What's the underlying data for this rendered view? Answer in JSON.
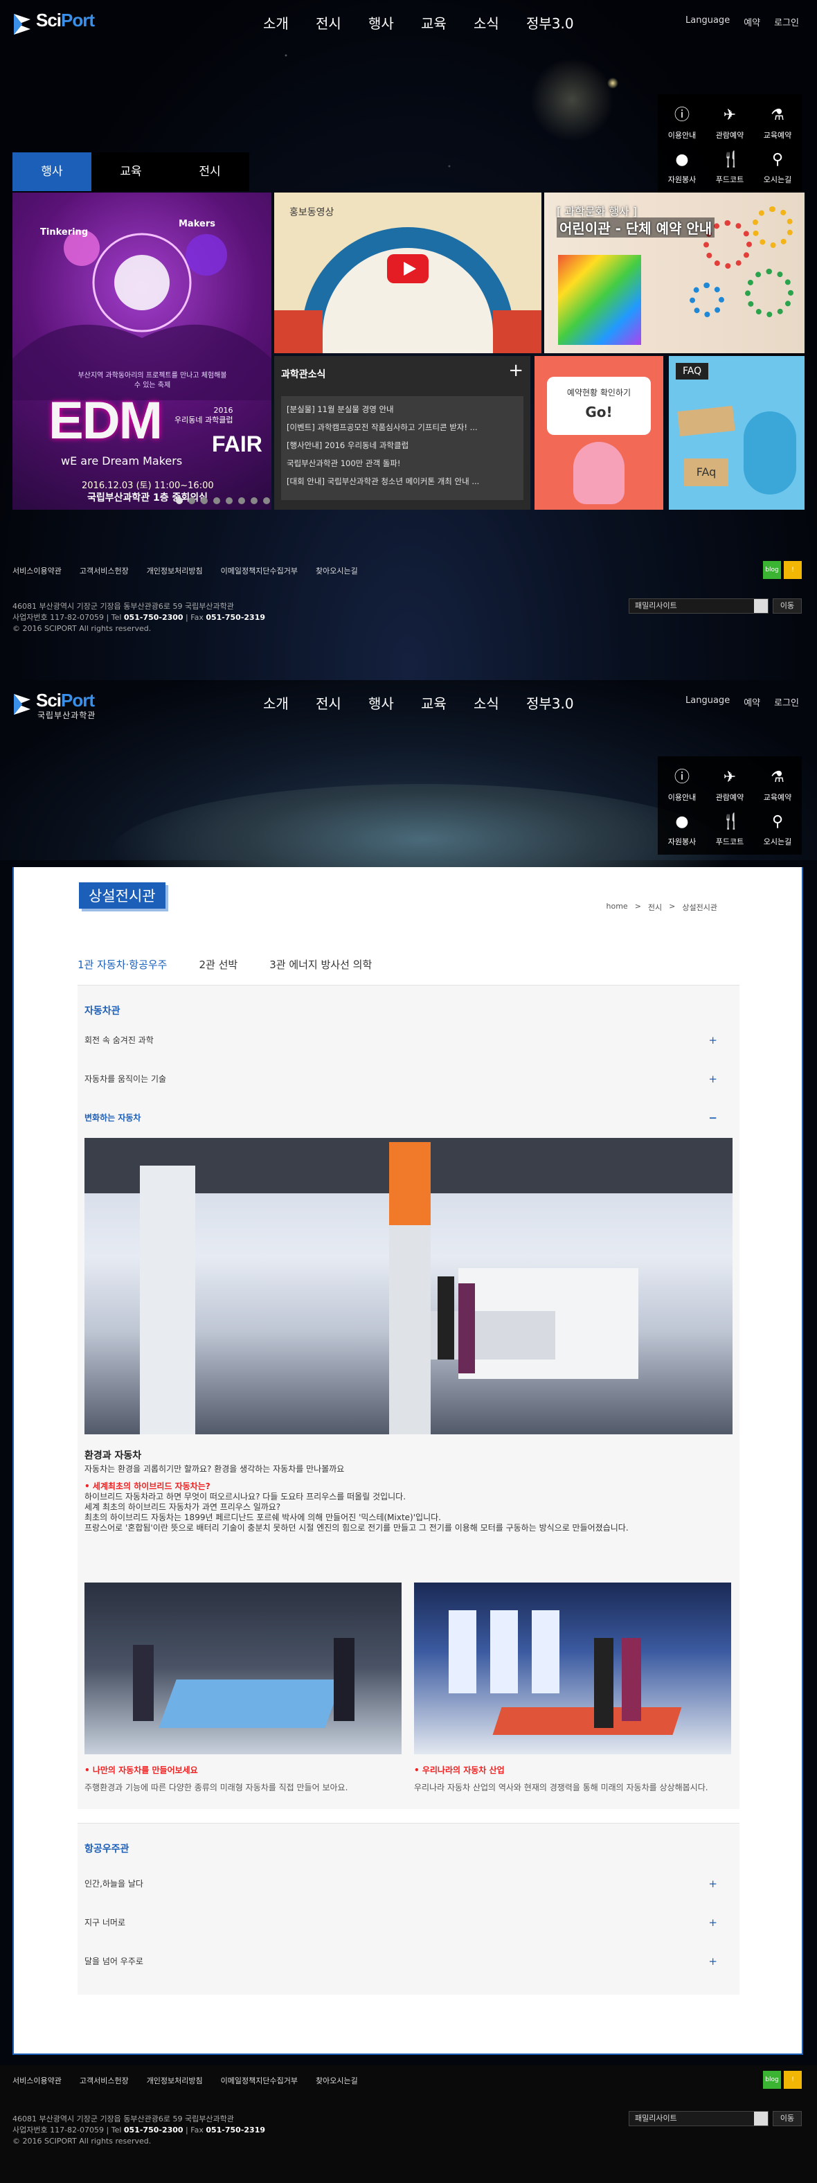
{
  "brand": {
    "name_a": "Sci",
    "name_b": "Port",
    "sub": "국립부산과학관"
  },
  "nav": [
    "소개",
    "전시",
    "행사",
    "교육",
    "소식",
    "정부3.0"
  ],
  "util": [
    "Language",
    "예약",
    "로그인"
  ],
  "quick": [
    {
      "label": "이용안내",
      "icon": "info-icon"
    },
    {
      "label": "관람예약",
      "icon": "plane-icon"
    },
    {
      "label": "교육예약",
      "icon": "flask-icon"
    },
    {
      "label": "자원봉사",
      "icon": "person-icon"
    },
    {
      "label": "푸드코트",
      "icon": "food-icon"
    },
    {
      "label": "오시는길",
      "icon": "pin-icon"
    }
  ],
  "tabs": [
    "행사",
    "교육",
    "전시"
  ],
  "edm": {
    "marks": [
      "Tinkering",
      "Makers"
    ],
    "msg": "부산지역 과학동아리의 프로젝트를 만나고 체험해볼 수 있는 축제",
    "yr": "2016\n우리동네 과학클럽",
    "big": "EDM",
    "fair": "FAIR",
    "we": "wE are Dream Makers",
    "date": "2016.12.03 (토) 11:00~16:00",
    "place": "국립부산과학관 1층 중회의실"
  },
  "video": {
    "label": "홍보동영상"
  },
  "event": {
    "kicker": "[ 과학문화 행사 ]",
    "title": "어린이관 - 단체 예약 안내"
  },
  "news": {
    "title": "과학관소식",
    "items": [
      "[분실물] 11월 분실물 경영 안내",
      "[이벤트] 과학캠프공모전 작품심사하고 기프티콘 받자! ...",
      "[행사안내] 2016 우리동네 과학클럽",
      "국립부산과학관 100만 관객 돌파!",
      "[대회 안내] 국립부산과학관 청소년 메이커톤 개최 안내 ..."
    ]
  },
  "reserve": {
    "line1": "예약현황 확인하기",
    "line2": "Go!"
  },
  "faq": {
    "label": "FAQ",
    "sign": "FAq"
  },
  "footer": {
    "links": [
      "서비스이용약관",
      "고객서비스헌장",
      "개인정보처리방침",
      "이메일정책지단수집거부",
      "찾아오시는길"
    ],
    "addr1": "46081 부산광역시 기장군 기장읍 동부산관광6로 59 국립부산과학관",
    "addr2a": "사업자번호 117-82-07059 | Tel ",
    "tel": "051-750-2300",
    "addr2b": " | Fax ",
    "fax": "051-750-2319",
    "copy": "© 2016 SCIPORT All rights reserved.",
    "family": "패밀리사이트",
    "go": "이동",
    "badge1": "blog",
    "badge2": "!"
  },
  "sub": {
    "title": "상설전시관",
    "breadcrumb": [
      "home",
      ">",
      "전시",
      ">",
      "상설전시관"
    ],
    "tabs": [
      "1관 자동차·항공우주",
      "2관 선박",
      "3관 에너지 방사선 의학"
    ],
    "sec1": {
      "head": "자동차관",
      "items": [
        {
          "label": "회전 속 숨겨진 과학",
          "pm": "+"
        },
        {
          "label": "자동차를 움직이는 기술",
          "pm": "+"
        },
        {
          "label": "변화하는 자동차",
          "pm": "−"
        }
      ],
      "h4": "환경과 자동차",
      "p1": "자동차는 환경을 괴롭히기만 할까요? 환경을 생각하는 자동차를 만나볼까요",
      "red": "• 세계최초의 하이브리드 자동차는?",
      "p2": "하이브리드 자동차라고 하면 무엇이 떠오르시나요? 다들 도요타 프리우스를 떠올릴 것입니다.",
      "p3": "세계 최초의 하이브리드 자동차가 과연 프리우스 일까요?",
      "p4": "최초의 하이브리드 자동차는 1899년 페르디난드 포르쉐 박사에 의해 만들어진 '믹스테(Mixte)'입니다.",
      "p5": "프랑스어로 '혼합됨'이란 뜻으로 배터리 기술이 충분치 못하던 시절 엔진의 힘으로 전기를 만들고 그 전기를 이용해 모터를 구동하는 방식으로 만들어졌습니다.",
      "c1h": "• 나만의 자동차를 만들어보세요",
      "c1p": "주행환경과 기능에 따른 다양한 종류의 미래형 자동차를 직접 만들어 보아요.",
      "c2h": "• 우리나라의 자동차 산업",
      "c2p": "우리나라 자동차 산업의 역사와 현재의 경쟁력을 통해 미래의 자동차를 상상해봅시다."
    },
    "sec2": {
      "head": "항공우주관",
      "items": [
        {
          "label": "인간,하늘을 날다",
          "pm": "+"
        },
        {
          "label": "지구 너머로",
          "pm": "+"
        },
        {
          "label": "달을 넘어 우주로",
          "pm": "+"
        }
      ]
    }
  },
  "colors": {
    "accent": "#1c5fb8",
    "red": "#e22222"
  }
}
